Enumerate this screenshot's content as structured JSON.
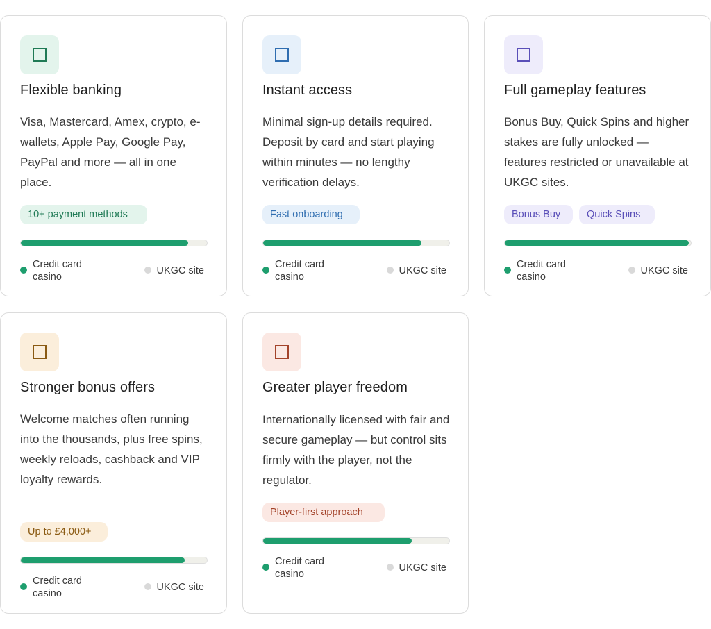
{
  "legend": {
    "credit_card": "Credit card casino",
    "ukgc": "UKGC site",
    "credit_card_color": "#1e9e6e",
    "ukgc_color": "#d9d9d9"
  },
  "cards": [
    {
      "icon": "square-outline-icon",
      "accent": "#1f7a55",
      "icon_bg": "#e3f4ec",
      "title": "Flexible banking",
      "description": "Visa, Mastercard, Amex, crypto, e-wallets, Apple Pay, Google Pay, PayPal and more — all in one place.",
      "badges": [
        "10+ payment methods"
      ],
      "badge_bg": "#e3f4ec",
      "badge_fg": "#1f7a55",
      "credit_card_share": 0.9
    },
    {
      "icon": "square-outline-icon",
      "accent": "#2f6db0",
      "icon_bg": "#e6f0fa",
      "title": "Instant access",
      "description": "Minimal sign-up details required. Deposit by card and start playing within minutes — no lengthy verification delays.",
      "badges": [
        "Fast onboarding"
      ],
      "badge_bg": "#e6f0fa",
      "badge_fg": "#2f6db0",
      "credit_card_share": 0.85
    },
    {
      "icon": "square-outline-icon",
      "accent": "#5a4fb8",
      "icon_bg": "#eeecfb",
      "title": "Full gameplay features",
      "description": "Bonus Buy, Quick Spins and higher stakes are fully unlocked — features restricted or unavailable at UKGC sites.",
      "badges": [
        "Bonus Buy",
        "Quick Spins"
      ],
      "badge_bg": "#eeecfb",
      "badge_fg": "#5a4fb8",
      "credit_card_share": 0.99
    },
    {
      "icon": "square-outline-icon",
      "accent": "#8a5a12",
      "icon_bg": "#fbeedb",
      "title": "Stronger bonus offers",
      "description": "Welcome matches often running into the thousands, plus free spins, weekly reloads, cashback and VIP loyalty rewards.",
      "badges": [
        "Up to £4,000+"
      ],
      "badge_bg": "#fbeedb",
      "badge_fg": "#8a5a12",
      "credit_card_share": 0.88
    },
    {
      "icon": "square-outline-icon",
      "accent": "#a3432a",
      "icon_bg": "#fbe8e3",
      "title": "Greater player freedom",
      "description": "Internationally licensed with fair and secure gameplay — but control sits firmly with the player, not the regulator.",
      "badges": [
        "Player-first approach"
      ],
      "badge_bg": "#fbe8e3",
      "badge_fg": "#a3432a",
      "credit_card_share": 0.8
    }
  ]
}
